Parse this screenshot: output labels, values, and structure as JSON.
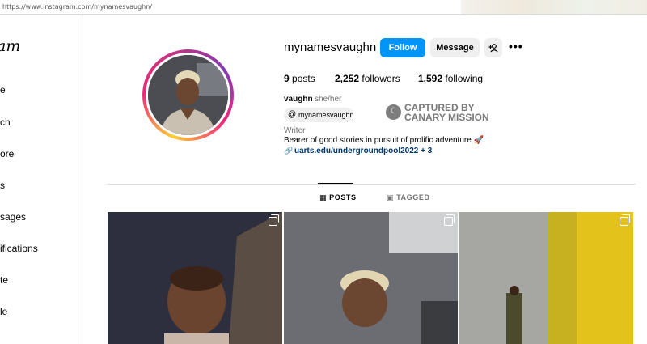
{
  "browser": {
    "url": "https://www.instagram.com/mynamesvaughn/"
  },
  "sidebar": {
    "logo_fragment": "am",
    "items": [
      {
        "label": "e"
      },
      {
        "label": "ch"
      },
      {
        "label": "ore"
      },
      {
        "label": "s"
      },
      {
        "label": "sages"
      },
      {
        "label": "ifications"
      },
      {
        "label": "te"
      },
      {
        "label": "le"
      }
    ]
  },
  "profile": {
    "username": "mynamesvaughn",
    "follow_label": "Follow",
    "message_label": "Message",
    "more_label": "•••",
    "stats": {
      "posts_count": "9",
      "posts_label": "posts",
      "followers_count": "2,252",
      "followers_label": "followers",
      "following_count": "1,592",
      "following_label": "following"
    },
    "full_name": "vaughn",
    "pronouns": "she/her",
    "threads_handle": "mynamesvaughn",
    "captured_line1": "CAPTURED BY",
    "captured_line2": "CANARY MISSION",
    "category": "Writer",
    "bio": "Bearer of good stories in pursuit of prolific adventure 🚀",
    "link": "uarts.edu/undergroundpool2022 + 3"
  },
  "tabs": [
    {
      "label": "POSTS",
      "icon": "grid-icon",
      "active": true
    },
    {
      "label": "TAGGED",
      "icon": "tagged-icon",
      "active": false
    }
  ],
  "colors": {
    "accent": "#0095f6",
    "link": "#00376b",
    "muted": "#737373",
    "divider": "#dbdbdb"
  }
}
